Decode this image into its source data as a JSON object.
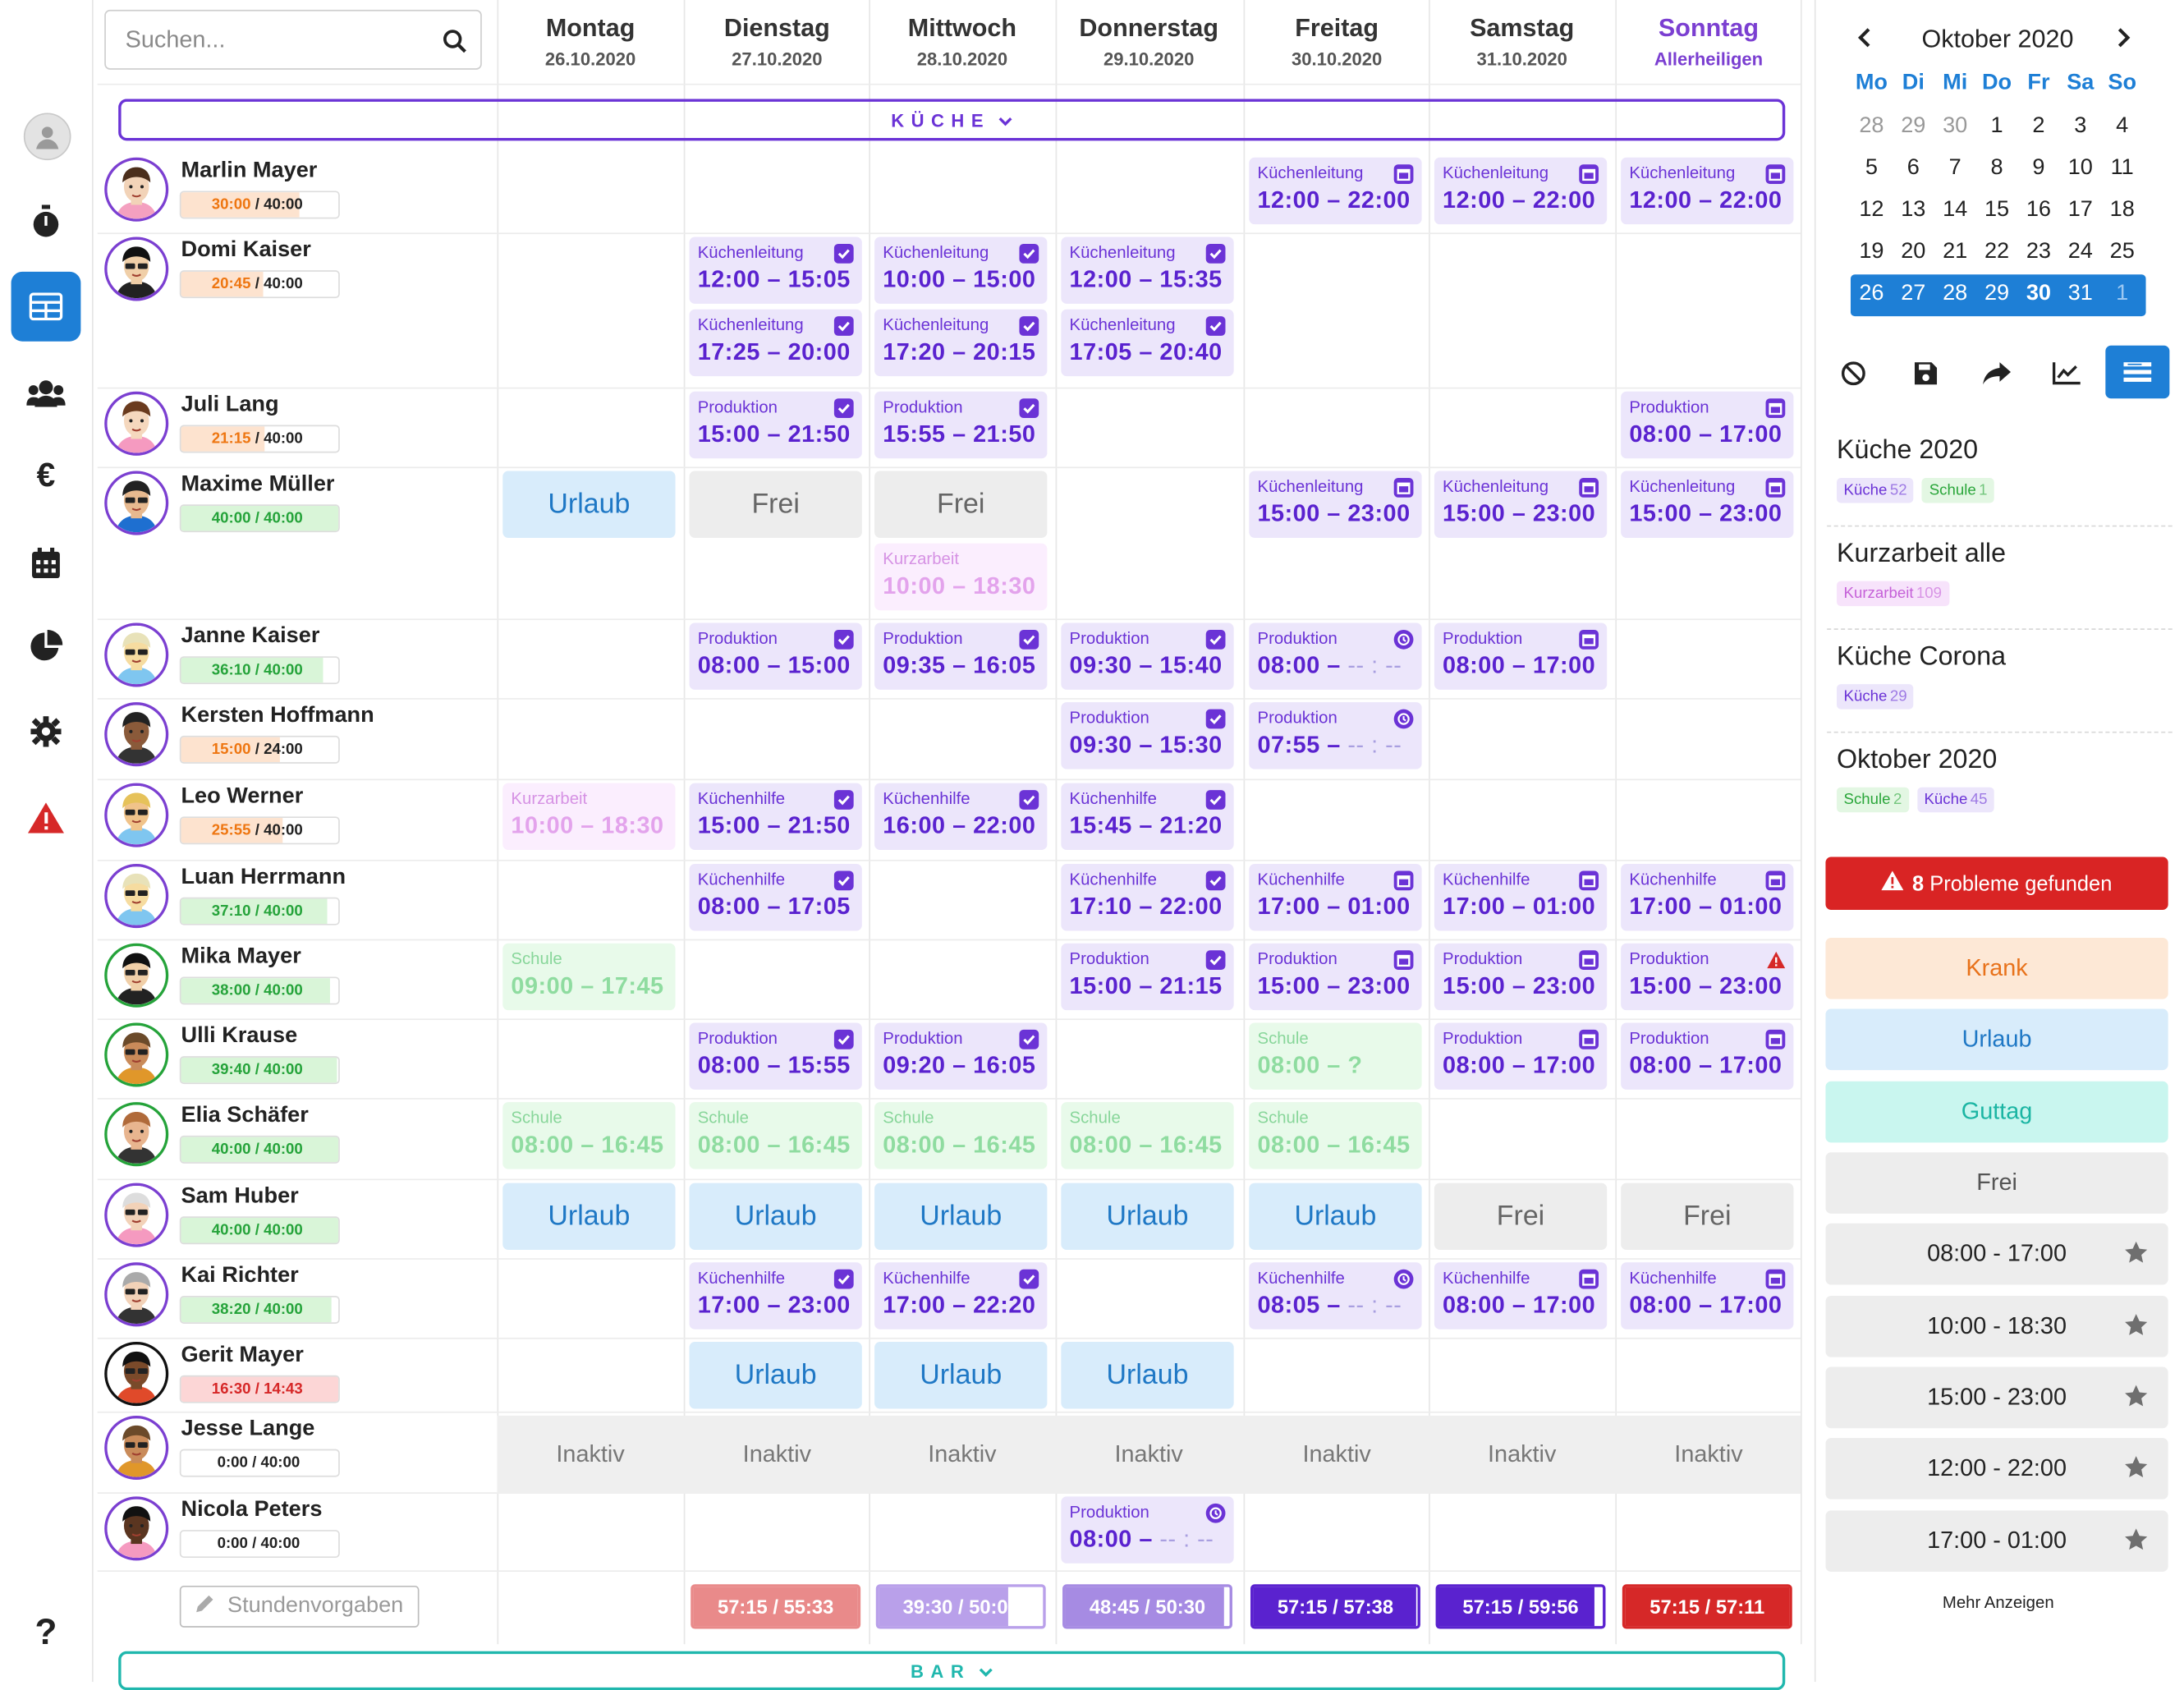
{
  "search": {
    "placeholder": "Suchen..."
  },
  "days": [
    {
      "name": "Montag",
      "date": "26.10.2020"
    },
    {
      "name": "Dienstag",
      "date": "27.10.2020"
    },
    {
      "name": "Mittwoch",
      "date": "28.10.2020"
    },
    {
      "name": "Donnerstag",
      "date": "29.10.2020"
    },
    {
      "name": "Freitag",
      "date": "30.10.2020"
    },
    {
      "name": "Samstag",
      "date": "31.10.2020"
    },
    {
      "name": "Sonntag",
      "date": "Allerheiligen"
    }
  ],
  "sections": {
    "kueche": "KÜCHE",
    "bar": "BAR"
  },
  "employees": [
    {
      "name": "Marlin Mayer",
      "hours_a": "30:00",
      "hours_b": "40:00",
      "status": "orange",
      "fill": 0.75
    },
    {
      "name": "Domi Kaiser",
      "hours_a": "20:45",
      "hours_b": "40:00",
      "status": "orange",
      "fill": 0.52
    },
    {
      "name": "Juli Lang",
      "hours_a": "21:15",
      "hours_b": "40:00",
      "status": "orange",
      "fill": 0.53
    },
    {
      "name": "Maxime Müller",
      "hours_a": "40:00",
      "hours_b": "40:00",
      "status": "green",
      "fill": 1.0
    },
    {
      "name": "Janne Kaiser",
      "hours_a": "36:10",
      "hours_b": "40:00",
      "status": "green",
      "fill": 0.9
    },
    {
      "name": "Kersten Hoffmann",
      "hours_a": "15:00",
      "hours_b": "24:00",
      "status": "orange",
      "fill": 0.63
    },
    {
      "name": "Leo Werner",
      "hours_a": "25:55",
      "hours_b": "40:00",
      "status": "orange",
      "fill": 0.65
    },
    {
      "name": "Luan Herrmann",
      "hours_a": "37:10",
      "hours_b": "40:00",
      "status": "green",
      "fill": 0.93
    },
    {
      "name": "Mika Mayer",
      "hours_a": "38:00",
      "hours_b": "40:00",
      "status": "green",
      "fill": 0.95
    },
    {
      "name": "Ulli Krause",
      "hours_a": "39:40",
      "hours_b": "40:00",
      "status": "green",
      "fill": 0.99
    },
    {
      "name": "Elia Schäfer",
      "hours_a": "40:00",
      "hours_b": "40:00",
      "status": "green",
      "fill": 1.0
    },
    {
      "name": "Sam Huber",
      "hours_a": "40:00",
      "hours_b": "40:00",
      "status": "green",
      "fill": 1.0
    },
    {
      "name": "Kai Richter",
      "hours_a": "38:20",
      "hours_b": "40:00",
      "status": "green",
      "fill": 0.96
    },
    {
      "name": "Gerit Mayer",
      "hours_a": "16:30",
      "hours_b": "14:43",
      "status": "red",
      "fill": 1.0
    },
    {
      "name": "Jesse Lange",
      "hours_a": "0:00",
      "hours_b": "40:00",
      "status": "gray",
      "fill": 0
    },
    {
      "name": "Nicola Peters",
      "hours_a": "0:00",
      "hours_b": "40:00",
      "status": "gray",
      "fill": 0
    }
  ],
  "shifts": [
    {
      "row": 0,
      "day": 4,
      "type": "purple",
      "label": "Küchenleitung",
      "time": "12:00 – 22:00",
      "icon": "calendar-icon"
    },
    {
      "row": 0,
      "day": 5,
      "type": "purple",
      "label": "Küchenleitung",
      "time": "12:00 – 22:00",
      "icon": "calendar-icon"
    },
    {
      "row": 0,
      "day": 6,
      "type": "purple",
      "label": "Küchenleitung",
      "time": "12:00 – 22:00",
      "icon": "calendar-icon"
    },
    {
      "row": 1,
      "day": 1,
      "type": "purple",
      "label": "Küchenleitung",
      "time": "12:00 – 15:05",
      "icon": "check-icon"
    },
    {
      "row": 1,
      "day": 2,
      "type": "purple",
      "label": "Küchenleitung",
      "time": "10:00 – 15:00",
      "icon": "check-icon"
    },
    {
      "row": 1,
      "day": 3,
      "type": "purple",
      "label": "Küchenleitung",
      "time": "12:00 – 15:35",
      "icon": "check-icon"
    },
    {
      "row": 1,
      "day": 1,
      "type": "purple",
      "sub": 1,
      "label": "Küchenleitung",
      "time": "17:25 – 20:00",
      "icon": "check-icon"
    },
    {
      "row": 1,
      "day": 2,
      "type": "purple",
      "sub": 1,
      "label": "Küchenleitung",
      "time": "17:20 – 20:15",
      "icon": "check-icon"
    },
    {
      "row": 1,
      "day": 3,
      "type": "purple",
      "sub": 1,
      "label": "Küchenleitung",
      "time": "17:05 – 20:40",
      "icon": "check-icon"
    },
    {
      "row": 2,
      "day": 1,
      "type": "purple",
      "label": "Produktion",
      "time": "15:00 – 21:50",
      "icon": "check-icon"
    },
    {
      "row": 2,
      "day": 2,
      "type": "purple",
      "label": "Produktion",
      "time": "15:55 – 21:50",
      "icon": "check-icon"
    },
    {
      "row": 2,
      "day": 6,
      "type": "purple",
      "label": "Produktion",
      "time": "08:00 – 17:00",
      "icon": "calendar-icon"
    },
    {
      "row": 3,
      "day": 0,
      "type": "urlaub",
      "text": "Urlaub"
    },
    {
      "row": 3,
      "day": 1,
      "type": "frei",
      "text": "Frei"
    },
    {
      "row": 3,
      "day": 2,
      "type": "frei",
      "text": "Frei"
    },
    {
      "row": 3,
      "day": 2,
      "type": "kurz",
      "sub": 1,
      "label": "Kurzarbeit",
      "time": "10:00 – 18:30"
    },
    {
      "row": 3,
      "day": 4,
      "type": "purple",
      "label": "Küchenleitung",
      "time": "15:00 – 23:00",
      "icon": "calendar-icon"
    },
    {
      "row": 3,
      "day": 5,
      "type": "purple",
      "label": "Küchenleitung",
      "time": "15:00 – 23:00",
      "icon": "calendar-icon"
    },
    {
      "row": 3,
      "day": 6,
      "type": "purple",
      "label": "Küchenleitung",
      "time": "15:00 – 23:00",
      "icon": "calendar-icon"
    },
    {
      "row": 4,
      "day": 1,
      "type": "purple",
      "label": "Produktion",
      "time": "08:00 – 15:00",
      "icon": "check-icon"
    },
    {
      "row": 4,
      "day": 2,
      "type": "purple",
      "label": "Produktion",
      "time": "09:35 – 16:05",
      "icon": "check-icon"
    },
    {
      "row": 4,
      "day": 3,
      "type": "purple",
      "label": "Produktion",
      "time": "09:30 – 15:40",
      "icon": "check-icon"
    },
    {
      "row": 4,
      "day": 4,
      "type": "purple",
      "label": "Produktion",
      "time": "08:00 – ",
      "time_open": "-- : --",
      "icon": "clock-icon"
    },
    {
      "row": 4,
      "day": 5,
      "type": "purple",
      "label": "Produktion",
      "time": "08:00 – 17:00",
      "icon": "calendar-icon"
    },
    {
      "row": 5,
      "day": 3,
      "type": "purple",
      "label": "Produktion",
      "time": "09:30 – 15:30",
      "icon": "check-icon"
    },
    {
      "row": 5,
      "day": 4,
      "type": "purple",
      "label": "Produktion",
      "time": "07:55 – ",
      "time_open": "-- : --",
      "icon": "clock-icon"
    },
    {
      "row": 6,
      "day": 0,
      "type": "kurz",
      "label": "Kurzarbeit",
      "time": "10:00 – 18:30"
    },
    {
      "row": 6,
      "day": 1,
      "type": "purple",
      "label": "Küchenhilfe",
      "time": "15:00 – 21:50",
      "icon": "check-icon"
    },
    {
      "row": 6,
      "day": 2,
      "type": "purple",
      "label": "Küchenhilfe",
      "time": "16:00 – 22:00",
      "icon": "check-icon"
    },
    {
      "row": 6,
      "day": 3,
      "type": "purple",
      "label": "Küchenhilfe",
      "time": "15:45 – 21:20",
      "icon": "check-icon"
    },
    {
      "row": 7,
      "day": 1,
      "type": "purple",
      "label": "Küchenhilfe",
      "time": "08:00 – 17:05",
      "icon": "check-icon"
    },
    {
      "row": 7,
      "day": 3,
      "type": "purple",
      "label": "Küchenhilfe",
      "time": "17:10 – 22:00",
      "icon": "check-icon"
    },
    {
      "row": 7,
      "day": 4,
      "type": "purple",
      "label": "Küchenhilfe",
      "time": "17:00 – 01:00",
      "icon": "calendar-icon"
    },
    {
      "row": 7,
      "day": 5,
      "type": "purple",
      "label": "Küchenhilfe",
      "time": "17:00 – 01:00",
      "icon": "calendar-icon"
    },
    {
      "row": 7,
      "day": 6,
      "type": "purple",
      "label": "Küchenhilfe",
      "time": "17:00 – 01:00",
      "icon": "calendar-icon"
    },
    {
      "row": 8,
      "day": 0,
      "type": "schule",
      "label": "Schule",
      "time": "09:00 – 17:45"
    },
    {
      "row": 8,
      "day": 3,
      "type": "purple",
      "label": "Produktion",
      "time": "15:00 – 21:15",
      "icon": "check-icon"
    },
    {
      "row": 8,
      "day": 4,
      "type": "purple",
      "label": "Produktion",
      "time": "15:00 – 23:00",
      "icon": "calendar-icon"
    },
    {
      "row": 8,
      "day": 5,
      "type": "purple",
      "label": "Produktion",
      "time": "15:00 – 23:00",
      "icon": "calendar-icon"
    },
    {
      "row": 8,
      "day": 6,
      "type": "purple",
      "label": "Produktion",
      "time": "15:00 – 23:00",
      "icon": "warning-icon"
    },
    {
      "row": 9,
      "day": 1,
      "type": "purple",
      "label": "Produktion",
      "time": "08:00 – 15:55",
      "icon": "check-icon"
    },
    {
      "row": 9,
      "day": 2,
      "type": "purple",
      "label": "Produktion",
      "time": "09:20 – 16:05",
      "icon": "check-icon"
    },
    {
      "row": 9,
      "day": 4,
      "type": "schule",
      "label": "Schule",
      "time": "08:00 – ?"
    },
    {
      "row": 9,
      "day": 5,
      "type": "purple",
      "label": "Produktion",
      "time": "08:00 – 17:00",
      "icon": "calendar-icon"
    },
    {
      "row": 9,
      "day": 6,
      "type": "purple",
      "label": "Produktion",
      "time": "08:00 – 17:00",
      "icon": "calendar-icon"
    },
    {
      "row": 10,
      "day": 0,
      "type": "schule",
      "label": "Schule",
      "time": "08:00 – 16:45"
    },
    {
      "row": 10,
      "day": 1,
      "type": "schule",
      "label": "Schule",
      "time": "08:00 – 16:45"
    },
    {
      "row": 10,
      "day": 2,
      "type": "schule",
      "label": "Schule",
      "time": "08:00 – 16:45"
    },
    {
      "row": 10,
      "day": 3,
      "type": "schule",
      "label": "Schule",
      "time": "08:00 – 16:45"
    },
    {
      "row": 10,
      "day": 4,
      "type": "schule",
      "label": "Schule",
      "time": "08:00 – 16:45"
    },
    {
      "row": 11,
      "day": 0,
      "type": "urlaub",
      "text": "Urlaub"
    },
    {
      "row": 11,
      "day": 1,
      "type": "urlaub",
      "text": "Urlaub"
    },
    {
      "row": 11,
      "day": 2,
      "type": "urlaub",
      "text": "Urlaub"
    },
    {
      "row": 11,
      "day": 3,
      "type": "urlaub",
      "text": "Urlaub"
    },
    {
      "row": 11,
      "day": 4,
      "type": "urlaub",
      "text": "Urlaub"
    },
    {
      "row": 11,
      "day": 5,
      "type": "frei",
      "text": "Frei"
    },
    {
      "row": 11,
      "day": 6,
      "type": "frei",
      "text": "Frei"
    },
    {
      "row": 12,
      "day": 1,
      "type": "purple",
      "label": "Küchenhilfe",
      "time": "17:00 – 23:00",
      "icon": "check-icon"
    },
    {
      "row": 12,
      "day": 2,
      "type": "purple",
      "label": "Küchenhilfe",
      "time": "17:00 – 22:20",
      "icon": "check-icon"
    },
    {
      "row": 12,
      "day": 4,
      "type": "purple",
      "label": "Küchenhilfe",
      "time": "08:05 – ",
      "time_open": "-- : --",
      "icon": "clock-icon"
    },
    {
      "row": 12,
      "day": 5,
      "type": "purple",
      "label": "Küchenhilfe",
      "time": "08:00 – 17:00",
      "icon": "calendar-icon"
    },
    {
      "row": 12,
      "day": 6,
      "type": "purple",
      "label": "Küchenhilfe",
      "time": "08:00 – 17:00",
      "icon": "calendar-icon"
    },
    {
      "row": 13,
      "day": 1,
      "type": "urlaub",
      "text": "Urlaub"
    },
    {
      "row": 13,
      "day": 2,
      "type": "urlaub",
      "text": "Urlaub"
    },
    {
      "row": 13,
      "day": 3,
      "type": "urlaub",
      "text": "Urlaub"
    },
    {
      "row": 15,
      "day": 3,
      "type": "purple",
      "label": "Produktion",
      "time": "08:00 – ",
      "time_open": "-- : --",
      "icon": "clock-icon"
    }
  ],
  "inactive_label": "Inaktiv",
  "stundenvorgaben": "Stundenvorgaben",
  "totals": [
    {
      "day": 1,
      "text": "57:15 / 55:33",
      "color": "#e98a8a",
      "fill": 1.0
    },
    {
      "day": 2,
      "text": "39:30 / 50:08",
      "color": "#b9a0ea",
      "fill": 0.79
    },
    {
      "day": 3,
      "text": "48:45 / 50:30",
      "color": "#a68be3",
      "fill": 0.97
    },
    {
      "day": 4,
      "text": "57:15 / 57:38",
      "color": "#5a22cf",
      "fill": 0.99
    },
    {
      "day": 5,
      "text": "57:15 / 59:56",
      "color": "#5a22cf",
      "fill": 0.95
    },
    {
      "day": 6,
      "text": "57:15 / 57:11",
      "color": "#d62828",
      "fill": 1.0
    }
  ],
  "calendar": {
    "title": "Oktober 2020",
    "weekdays": [
      "Mo",
      "Di",
      "Mi",
      "Do",
      "Fr",
      "Sa",
      "So"
    ],
    "weeks": [
      [
        "28",
        "29",
        "30",
        "1",
        "2",
        "3",
        "4"
      ],
      [
        "5",
        "6",
        "7",
        "8",
        "9",
        "10",
        "11"
      ],
      [
        "12",
        "13",
        "14",
        "15",
        "16",
        "17",
        "18"
      ],
      [
        "19",
        "20",
        "21",
        "22",
        "23",
        "24",
        "25"
      ],
      [
        "26",
        "27",
        "28",
        "29",
        "30",
        "31",
        "1"
      ]
    ]
  },
  "toolbar": [
    "ban-icon",
    "save-icon",
    "share-icon",
    "chart-icon",
    "list-view-icon"
  ],
  "plans": [
    {
      "title": "Küche 2020",
      "tags": [
        {
          "kind": "k",
          "label": "Küche",
          "count": "52"
        },
        {
          "kind": "s",
          "label": "Schule",
          "count": "1"
        }
      ]
    },
    {
      "title": "Kurzarbeit alle",
      "tags": [
        {
          "kind": "kz",
          "label": "Kurzarbeit",
          "count": "109"
        }
      ]
    },
    {
      "title": "Küche Corona",
      "tags": [
        {
          "kind": "k",
          "label": "Küche",
          "count": "29"
        }
      ]
    },
    {
      "title": "Oktober 2020",
      "tags": [
        {
          "kind": "s",
          "label": "Schule",
          "count": "2"
        },
        {
          "kind": "k",
          "label": "Küche",
          "count": "45"
        }
      ]
    }
  ],
  "problems": {
    "count": "8",
    "label": "Probleme gefunden"
  },
  "quick_buttons": [
    {
      "label": "Krank",
      "bg": "#fde8d6",
      "fg": "#e8721b",
      "star": false
    },
    {
      "label": "Urlaub",
      "bg": "#d8ecfb",
      "fg": "#1f78c5",
      "star": false
    },
    {
      "label": "Guttag",
      "bg": "#c9f6ef",
      "fg": "#1bb5a3",
      "star": false
    },
    {
      "label": "Frei",
      "bg": "#ededed",
      "fg": "#555",
      "star": false
    },
    {
      "label": "08:00 - 17:00",
      "bg": "#ededed",
      "fg": "#222",
      "star": true
    },
    {
      "label": "10:00 - 18:30",
      "bg": "#ededed",
      "fg": "#222",
      "star": true
    },
    {
      "label": "15:00 - 23:00",
      "bg": "#ededed",
      "fg": "#222",
      "star": true
    },
    {
      "label": "12:00 - 22:00",
      "bg": "#ededed",
      "fg": "#222",
      "star": true
    },
    {
      "label": "17:00 - 01:00",
      "bg": "#ededed",
      "fg": "#222",
      "star": true
    }
  ],
  "mehr": "Mehr Anzeigen"
}
